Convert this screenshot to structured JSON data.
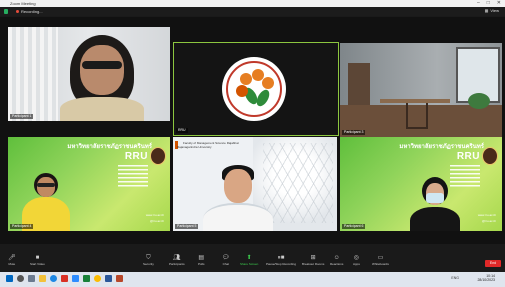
{
  "window": {
    "title": "Zoom Meeting",
    "controls": [
      "–",
      "□",
      "✕"
    ]
  },
  "topbar": {
    "recording_label": "Recording...",
    "view_label": "View"
  },
  "participants": [
    {
      "name": "Participant 1"
    },
    {
      "name": "RRU"
    },
    {
      "name": "Participant 3"
    },
    {
      "name": "Participant 4"
    },
    {
      "name": "Participant 5"
    },
    {
      "name": "Participant 6"
    }
  ],
  "slide": {
    "brand": "RRU",
    "header": "มหาวิทยาลัยราชภัฏราชนครินทร์",
    "website": "www.rru.ac.th",
    "social": "@rru.ac.th"
  },
  "background": {
    "faculty": "Faculty of Management Science Rajabhat Rajanagarindra University"
  },
  "toolbar": {
    "mute": "Mute",
    "stop_video": "Start Video",
    "security": "Security",
    "participants": "Participants",
    "participants_count": "5",
    "polls": "Polls",
    "chat": "Chat",
    "share_screen": "Share Screen",
    "record": "Pause/Stop Recording",
    "breakout": "Breakout Rooms",
    "reactions": "Reactions",
    "apps": "Apps",
    "whiteboards": "Whiteboards",
    "end": "End"
  },
  "taskbar": {
    "time": "10:14",
    "date": "28/10/2023",
    "lang": "ENG"
  },
  "colors": {
    "active_speaker": "#8cc63f",
    "end_button": "#e02828",
    "slide_green": "#7cc94a"
  }
}
